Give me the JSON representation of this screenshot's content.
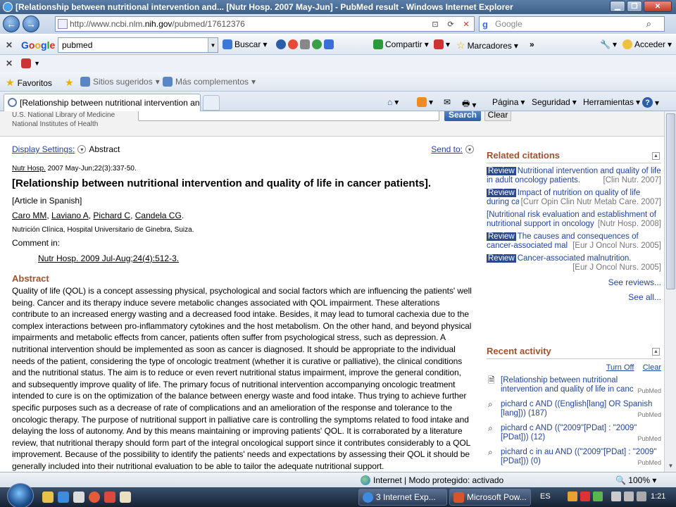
{
  "window": {
    "title": "[Relationship between nutritional intervention and... [Nutr Hosp. 2007 May-Jun] - PubMed result - Windows Internet Explorer"
  },
  "address": {
    "url_prefix": "http://www.ncbi.nlm.",
    "url_host": "nih.gov",
    "url_path": "/pubmed/17612376",
    "search_placeholder": "Google"
  },
  "google_toolbar": {
    "logo": [
      "G",
      "o",
      "o",
      "g",
      "l",
      "e"
    ],
    "query": "pubmed",
    "search_label": "Buscar",
    "share_label": "Compartir",
    "bookmarks_label": "Marcadores",
    "more": "»",
    "signin_label": "Acceder"
  },
  "favorites_bar": {
    "favorites_label": "Favoritos",
    "suggested_label": "Sitios sugeridos",
    "addons_label": "Más complementos"
  },
  "tab": {
    "label": "[Relationship between nutritional intervention an...",
    "page_menu": "Página",
    "safety_menu": "Seguridad",
    "tools_menu": "Herramientas"
  },
  "pubmed_header": {
    "org_line1": "U.S. National Library of Medicine",
    "org_line2": "National Institutes of Health",
    "search_button": "Search",
    "clear_button": "Clear"
  },
  "article": {
    "display_settings": "Display Settings:",
    "format": "Abstract",
    "send_to": "Send to:",
    "journal": "Nutr Hosp.",
    "citation": "2007 May-Jun;22(3):337-50.",
    "title": "[Relationship between nutritional intervention and quality of life in cancer patients].",
    "language_note": "[Article in Spanish]",
    "authors": [
      "Caro MM",
      "Laviano A",
      "Pichard C",
      "Candela CG"
    ],
    "affiliation": "Nutrición Clínica, Hospital Universitario de Ginebra, Suiza.",
    "comment_label": "Comment in:",
    "comment_ref": "Nutr Hosp. 2009 Jul-Aug;24(4):512-3.",
    "abstract_heading": "Abstract",
    "abstract_text": "Quality of life (QOL) is a concept assessing physical, psychological and social factors which are influencing the patients' well being. Cancer and its therapy induce severe metabolic changes associated with QOL impairment. These alterations contribute to an increased energy wasting and a decreased food intake. Besides, it may lead to tumoral cachexia due to the complex interactions between pro-inflammatory cytokines and the host metabolism. On the other hand, and beyond physical impairments and metabolic effects from cancer, patients often suffer from psychological stress, such as depression. A nutritional intervention should be implemented as soon as cancer is diagnosed. It should be appropriate to the individual needs of the patient, considering the type of oncologic treatment (whether it is curative or palliative), the clinical conditions and the nutritional status. The aim is to reduce or even revert nutritional status impairment, improve the general condition, and subsequently improve quality of life. The primary focus of nutritional intervention accompanying oncologic treatment intended to cure is on the optimization of the balance between energy waste and food intake. Thus trying to achieve further specific purposes such as a decrease of rate of complications and an amelioration of the response and tolerance to the oncologic therapy. The purpose of nutritional support in palliative care is controlling the symptoms related to food intake and delaying the loss of autonomy. And by this means maintaining or improving patients' QOL. It is corraborated by a literature review, that nutritional therapy should form part of the integral oncological support since it contributes considerably to a QOL improvement. Because of the possibility to identify the patients' needs and expectations by assessing their QOL it should be generally included into their nutritional evaluation to be able to tailor the adequate nutritional support."
  },
  "related": {
    "heading": "Related citations",
    "review_tag": "Review",
    "items": [
      {
        "review": true,
        "title": "Nutritional intervention and quality of life in adult oncology patients.",
        "source": "[Clin Nutr. 2007]"
      },
      {
        "review": true,
        "title": "Impact of nutrition on quality of life during ca",
        "source": "[Curr Opin Clin Nutr Metab Care. 2007]"
      },
      {
        "review": false,
        "title": "[Nutritional risk evaluation and establishment of nutritional support in oncology",
        "source": "[Nutr Hosp. 2008]"
      },
      {
        "review": true,
        "title": "The causes and consequences of cancer-associated mal",
        "source": "[Eur J Oncol Nurs. 2005]"
      },
      {
        "review": true,
        "title": "Cancer-associated malnutrition.",
        "source": "[Eur J Oncol Nurs. 2005]"
      }
    ],
    "see_reviews": "See reviews...",
    "see_all": "See all..."
  },
  "recent": {
    "heading": "Recent activity",
    "turn_off": "Turn Off",
    "clear": "Clear",
    "items": [
      {
        "icon": "document-icon",
        "text": "[Relationship between nutritional intervention and quality of life in canc",
        "source": "PubMed"
      },
      {
        "icon": "search-icon",
        "text": "pichard c AND ((English[lang] OR Spanish [lang])) (187)",
        "source": "PubMed"
      },
      {
        "icon": "search-icon",
        "text": "pichard c AND ((\"2009\"[PDat] : \"2009\"[PDat])) (12)",
        "source": "PubMed"
      },
      {
        "icon": "search-icon",
        "text": "pichard c in au AND ((\"2009\"[PDat] : \"2009\"[PDat])) (0)",
        "source": "PubMed"
      }
    ]
  },
  "status": {
    "zone": "Internet | Modo protegido: activado",
    "zoom": "100%"
  },
  "taskbar": {
    "ie_button": "3 Internet Exp...",
    "ppt_button": "Microsoft Pow...",
    "lang": "ES",
    "time": "1:21"
  }
}
